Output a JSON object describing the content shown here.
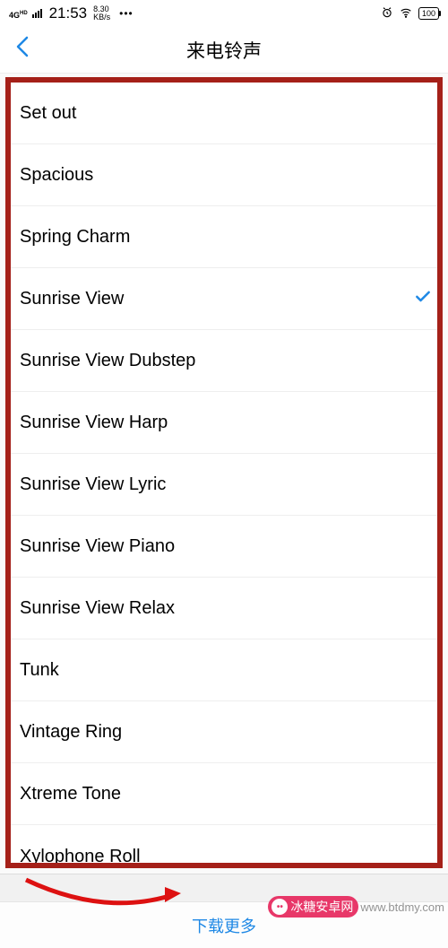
{
  "statusbar": {
    "network_type": "4G",
    "hd": "HD",
    "time": "21:53",
    "speed_value": "8.30",
    "speed_unit": "KB/s",
    "dots": "•••",
    "battery": "100"
  },
  "navbar": {
    "title": "来电铃声"
  },
  "ringtones": [
    {
      "label": "Set out",
      "selected": false
    },
    {
      "label": "Spacious",
      "selected": false
    },
    {
      "label": "Spring Charm",
      "selected": false
    },
    {
      "label": "Sunrise View",
      "selected": true
    },
    {
      "label": "Sunrise View Dubstep",
      "selected": false
    },
    {
      "label": "Sunrise View Harp",
      "selected": false
    },
    {
      "label": "Sunrise View Lyric",
      "selected": false
    },
    {
      "label": "Sunrise View Piano",
      "selected": false
    },
    {
      "label": "Sunrise View Relax",
      "selected": false
    },
    {
      "label": "Tunk",
      "selected": false
    },
    {
      "label": "Vintage Ring",
      "selected": false
    },
    {
      "label": "Xtreme Tone",
      "selected": false
    },
    {
      "label": "Xylophone Roll",
      "selected": false
    }
  ],
  "footer": {
    "download_more": "下载更多"
  },
  "watermark": {
    "brand": "冰糖安卓网",
    "url": "www.btdmy.com"
  }
}
